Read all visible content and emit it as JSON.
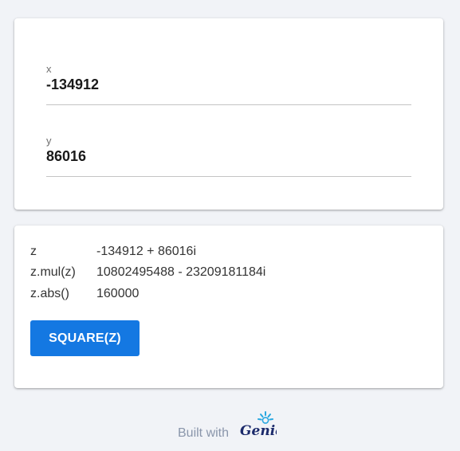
{
  "inputs": {
    "x": {
      "label": "x",
      "value": "-134912"
    },
    "y": {
      "label": "y",
      "value": "86016"
    }
  },
  "results": {
    "rows": [
      {
        "key": "z",
        "value": "-134912 + 86016i"
      },
      {
        "key": "z.mul(z)",
        "value": "10802495488 - 23209181184i"
      },
      {
        "key": "z.abs()",
        "value": "160000"
      }
    ],
    "square_button_label": "SQUARE(Z)"
  },
  "footer": {
    "built_with": "Built with",
    "logo_text": "Genie",
    "logo_icon": "genie-logo-icon"
  },
  "colors": {
    "background": "#f1f3f7",
    "button": "#1478e2",
    "logo": "#1b2a6b",
    "logo_accent": "#29a8e0"
  }
}
